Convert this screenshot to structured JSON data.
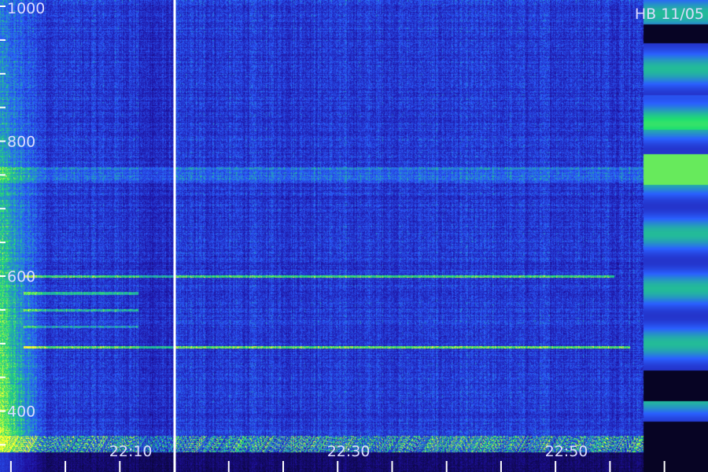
{
  "chart_data": {
    "type": "heatmap",
    "station_tag": "HB 11/05",
    "y_ticks": [
      {
        "label": "1000",
        "value": 1000
      },
      {
        "label": "800",
        "value": 800
      },
      {
        "label": "600",
        "value": 600
      },
      {
        "label": "400",
        "value": 400
      }
    ],
    "ylim": [
      320,
      1000
    ],
    "x_ticks": [
      {
        "label": "22:10",
        "value": "22:10"
      },
      {
        "label": "22:30",
        "value": "22:30"
      },
      {
        "label": "22:50",
        "value": "22:50"
      }
    ],
    "xlim": [
      "21:58",
      "23:03"
    ],
    "divider_time": "22:14",
    "colors": {
      "background": "#000000",
      "low": "#1e10a0",
      "mid": "#2a60ff",
      "high": "#20e070",
      "peak": "#ffff30",
      "text": "#dcdcff",
      "axis": "#ffffff"
    }
  }
}
